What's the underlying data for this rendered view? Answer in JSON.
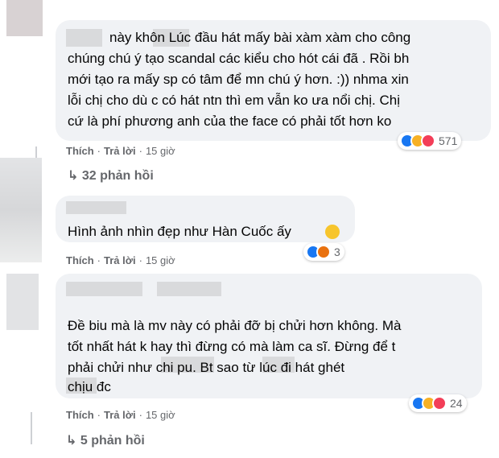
{
  "comments": [
    {
      "lines": [
        "này khôn       Lúc đầu hát mấy bài xàm xàm cho công",
        "chúng chú ý tạo scandal các kiểu cho hót cái đã . Rồi bh",
        "mới tạo ra mấy sp có tâm để mn chú ý hơn. :)) nhma xin",
        "lỗi chị cho dù c có hát ntn thì em vẫn ko ưa nổi chị. Chị",
        "cứ là phí phương anh của the face có phải tốt hơn ko"
      ],
      "like": "Thích",
      "reply": "Trả lời",
      "time": "15 giờ",
      "reactions": {
        "icons": [
          "like-icon",
          "haha-icon",
          "love-icon"
        ],
        "count": "571"
      },
      "replies_label": "32 phản hồi"
    },
    {
      "lines": [
        "Hình ảnh nhìn đẹp như Hàn Cuốc ấy"
      ],
      "like": "Thích",
      "reply": "Trả lời",
      "time": "15 giờ",
      "reactions": {
        "icons": [
          "like-icon",
          "angry-icon"
        ],
        "count": "3"
      }
    },
    {
      "lines": [
        "Đề biu mà là mv này có phải đỡ bị chửi hơn không. Mà",
        "tốt nhất hát k hay thì đừng có mà làm ca sĩ. Đừng để t",
        "phải chửi như          chi pu. Bt          sao từ lúc đi hát ghét",
        "          chịu đc"
      ],
      "like": "Thích",
      "reply": "Trả lời",
      "time": "15 giờ",
      "reactions": {
        "icons": [
          "like-icon",
          "haha-icon",
          "love-icon"
        ],
        "count": "24"
      },
      "replies_label": "5 phản hồi"
    }
  ],
  "colors": {
    "bubble": "#f0f2f5",
    "meta": "#65676b",
    "like": "#1877f2",
    "love": "#f33e58",
    "haha": "#f7b125",
    "angry": "#e9710f"
  }
}
